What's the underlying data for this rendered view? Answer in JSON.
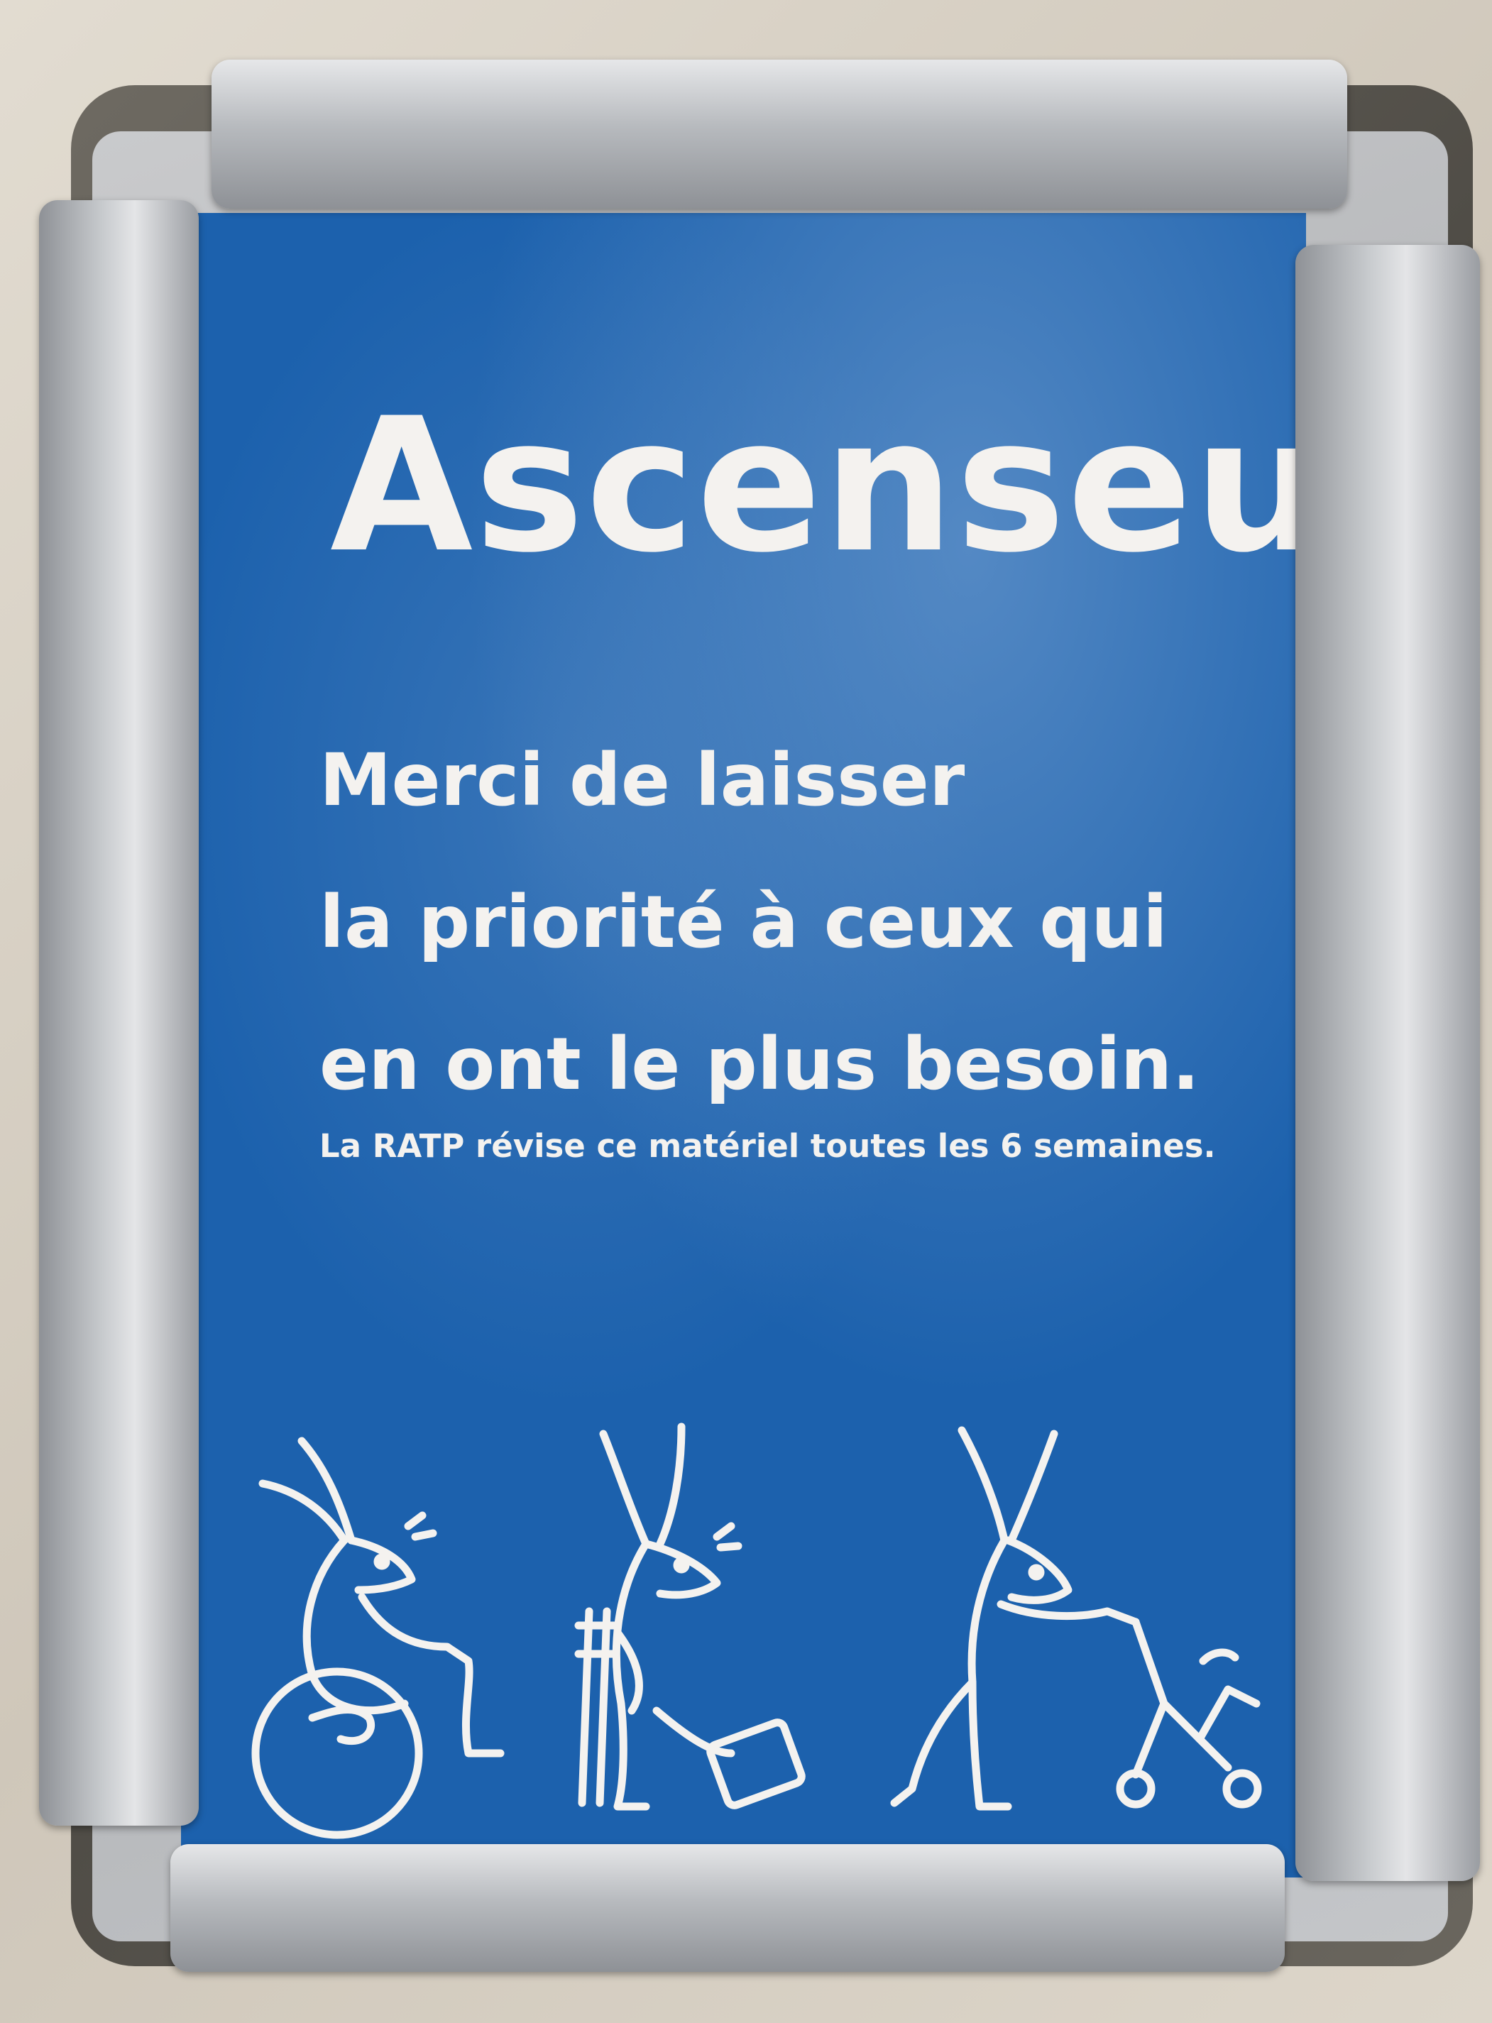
{
  "sign": {
    "title": "Ascenseur",
    "message_lines": [
      "Merci de laisser",
      "la priorité à ceux qui",
      "en ont le plus besoin."
    ],
    "footnote": "La RATP révise ce matériel toutes les 6 semaines.",
    "background_color": "#1c61ad",
    "text_color": "#f4f2ef"
  },
  "illustrations": [
    {
      "icon": "rabbit-wheelchair-icon"
    },
    {
      "icon": "rabbit-crutch-cast-icon"
    },
    {
      "icon": "rabbit-stroller-icon"
    }
  ],
  "frame": {
    "type": "snap-frame",
    "color": "#b7babe"
  }
}
